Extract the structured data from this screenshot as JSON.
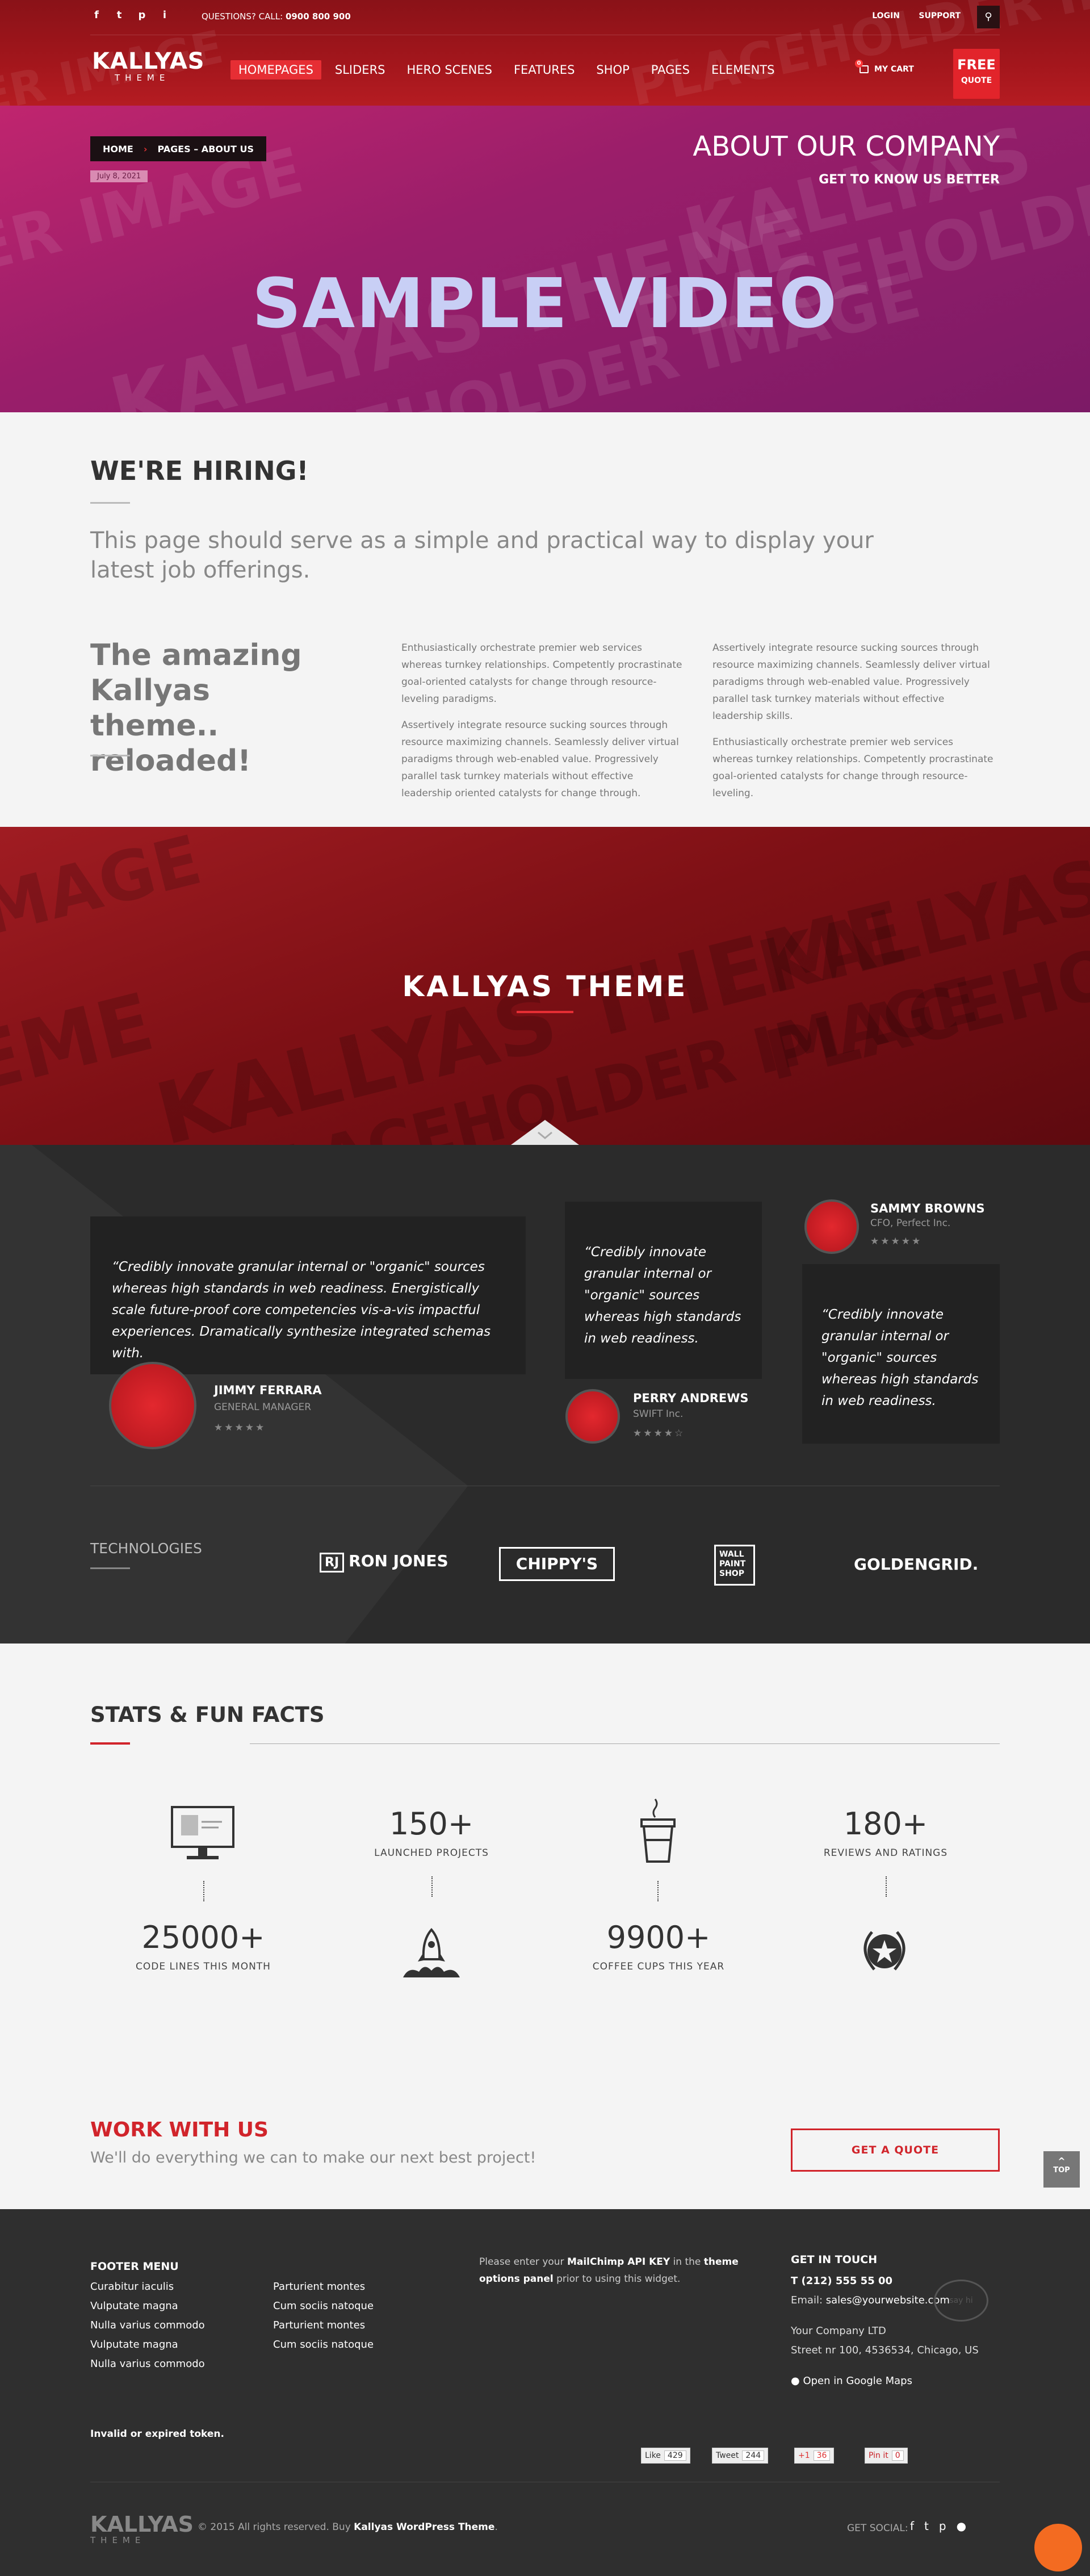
{
  "header": {
    "social": [
      "f",
      "t",
      "p",
      "i"
    ],
    "call_label": "QUESTIONS? CALL:",
    "call_number": "0900 800 900",
    "login": "LOGIN",
    "support": "SUPPORT",
    "logo_main": "KALLYAS",
    "logo_sub": "THEME",
    "nav": [
      "HOMEPAGES",
      "SLIDERS",
      "HERO SCENES",
      "FEATURES",
      "SHOP",
      "PAGES",
      "ELEMENTS"
    ],
    "cart_label": "MY CART",
    "cart_count": "0",
    "quote_top": "FREE",
    "quote_bottom": "QUOTE"
  },
  "hero": {
    "breadcrumb_home": "HOME",
    "breadcrumb_current": "PAGES – ABOUT US",
    "date": "July 8, 2021",
    "title": "ABOUT OUR COMPANY",
    "subtitle": "GET TO KNOW US BETTER",
    "video_text": "SAMPLE VIDEO"
  },
  "hiring": {
    "heading": "WE'RE HIRING!",
    "lead": "This page should serve as a simple and practical way to display your latest job offerings.",
    "amazing": "The amazing Kallyas theme.. reloaded!",
    "col1": [
      "Enthusiastically orchestrate premier web services whereas turnkey relationships. Competently procrastinate goal-oriented catalysts for change through resource-leveling paradigms.",
      "Assertively integrate resource sucking sources through resource maximizing channels. Seamlessly deliver virtual paradigms through web-enabled value. Progressively parallel task turnkey materials without effective leadership oriented catalysts for change through."
    ],
    "col2": [
      "Assertively integrate resource sucking sources through resource maximizing channels. Seamlessly deliver virtual paradigms through web-enabled value. Progressively parallel task turnkey materials without effective leadership skills.",
      "Enthusiastically orchestrate premier web services whereas turnkey relationships. Competently procrastinate goal-oriented catalysts for change through resource-leveling."
    ]
  },
  "banner": {
    "title": "KALLYAS THEME"
  },
  "testimonials": {
    "items": [
      {
        "quote": "“Credibly innovate granular internal or \"organic\" sources whereas high standards in web readiness. Energistically scale future-proof core competencies vis-a-vis impactful experiences. Dramatically synthesize integrated schemas with.",
        "name": "JIMMY FERRARA",
        "role": "GENERAL MANAGER",
        "stars": "★★★★★"
      },
      {
        "quote": "“Credibly innovate granular internal or \"organic\" sources whereas high standards in web readiness.",
        "name": "PERRY ANDREWS",
        "role": "SWIFT Inc.",
        "stars": "★★★★☆"
      },
      {
        "quote": "“Credibly innovate granular internal or \"organic\" sources whereas high standards in web readiness.",
        "name": "SAMMY BROWNS",
        "role": "CFO, Perfect Inc.",
        "stars": "★★★★★"
      }
    ],
    "tech_label": "TECHNOLOGIES",
    "logos": [
      "RON JONES",
      "CHIPPY'S",
      "WALL PAINT SHOP",
      "GOLDENGRID."
    ]
  },
  "stats": {
    "heading": "STATS & FUN FACTS",
    "items": [
      {
        "num": "150+",
        "label": "LAUNCHED PROJECTS"
      },
      {
        "num": "180+",
        "label": "REVIEWS AND RATINGS"
      },
      {
        "num": "25000+",
        "label": "CODE LINES THIS MONTH"
      },
      {
        "num": "9900+",
        "label": "COFFEE CUPS THIS YEAR"
      }
    ]
  },
  "work": {
    "heading": "WORK WITH US",
    "sub": "We'll do everything we can to make our next best project!",
    "button": "GET A QUOTE",
    "top": "TOP"
  },
  "footer": {
    "menu_title": "FOOTER MENU",
    "menu_col1": [
      "Curabitur iaculis",
      "Vulputate magna",
      "Nulla varius commodo",
      "Vulputate magna",
      "Nulla varius commodo"
    ],
    "menu_col2": [
      "Parturient montes",
      "Cum sociis natoque",
      "Parturient montes",
      "Cum sociis natoque"
    ],
    "mc_1": "Please enter your ",
    "mc_2": "MailChimp API KEY",
    "mc_3": " in the ",
    "mc_4": "theme options panel",
    "mc_5": " prior to using this widget.",
    "contact_title": "GET IN TOUCH",
    "phone": "T (212) 555 55 00",
    "email_label": "Email: ",
    "email": "sales@yourwebsite.com",
    "company": "Your Company LTD",
    "address": "Street nr 100, 4536534, Chicago, US",
    "maps": "Open in Google Maps",
    "bubble": "say hi",
    "token": "Invalid or expired token.",
    "like": "Like",
    "like_count": "429",
    "tweet": "Tweet",
    "tweet_count": "244",
    "gplus": "+1",
    "gplus_count": "36",
    "pin": "Pin it",
    "pin_count": "0",
    "logo_main": "KALLYAS",
    "logo_sub": "THEME",
    "copy_1": "© 2015 All rights reserved. Buy ",
    "copy_2": "Kallyas WordPress Theme",
    "copy_3": ".",
    "get_social": "GET SOCIAL:"
  }
}
